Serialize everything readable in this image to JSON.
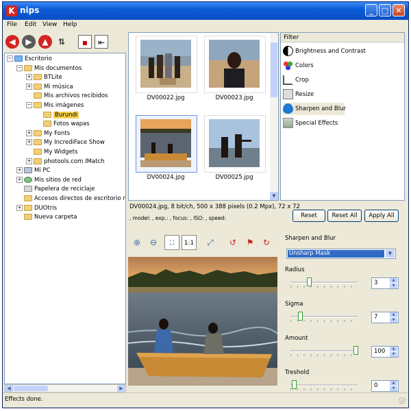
{
  "window": {
    "app_icon_glyph": "K",
    "title": "nips",
    "controls": {
      "minimize": "_",
      "maximize": "□",
      "close": "✕"
    }
  },
  "menu": [
    "File",
    "Edit",
    "View",
    "Help"
  ],
  "toolbar": [
    {
      "name": "back-icon",
      "glyph": "◀",
      "color": "#d32424"
    },
    {
      "name": "forward-icon",
      "glyph": "▶",
      "color": "#5a5a5a"
    },
    {
      "name": "up-icon",
      "glyph": "▲",
      "color": "#d32424"
    },
    {
      "name": "refresh-icon",
      "glyph": "⇅",
      "color": "#333333"
    }
  ],
  "tree": [
    {
      "label": "Escritorio",
      "depth": 0,
      "expander": "−",
      "folder": "desktop"
    },
    {
      "label": "Mis documentos",
      "depth": 1,
      "expander": "−",
      "folder": "docs"
    },
    {
      "label": "BTLite",
      "depth": 2,
      "expander": "+"
    },
    {
      "label": "Mi música",
      "depth": 2,
      "expander": "+"
    },
    {
      "label": "Mis archivos recibidos",
      "depth": 2,
      "expander": ""
    },
    {
      "label": "Mis imágenes",
      "depth": 2,
      "expander": "−"
    },
    {
      "label": "Burundi",
      "depth": 3,
      "expander": "",
      "selected": true
    },
    {
      "label": "Fotos wapas",
      "depth": 3,
      "expander": ""
    },
    {
      "label": "My Fonts",
      "depth": 2,
      "expander": "+"
    },
    {
      "label": "My IncrediFace Show",
      "depth": 2,
      "expander": "+"
    },
    {
      "label": "My Widgets",
      "depth": 2,
      "expander": ""
    },
    {
      "label": "photools.com IMatch",
      "depth": 2,
      "expander": "+"
    },
    {
      "label": "Mi PC",
      "depth": 1,
      "expander": "+",
      "folder": "pc"
    },
    {
      "label": "Mis sitios de red",
      "depth": 1,
      "expander": "+",
      "folder": "net"
    },
    {
      "label": "Papelera de reciclaje",
      "depth": 1,
      "expander": "",
      "folder": "trash"
    },
    {
      "label": "Accesos directos de escritorio no u",
      "depth": 1,
      "expander": ""
    },
    {
      "label": "DUOtris",
      "depth": 1,
      "expander": "+"
    },
    {
      "label": "Nueva carpeta",
      "depth": 1,
      "expander": ""
    }
  ],
  "thumbnails": [
    {
      "caption": "DV00022.jpg",
      "active": false
    },
    {
      "caption": "DV00023.jpg",
      "active": false
    },
    {
      "caption": "DV00024.jpg",
      "active": true
    },
    {
      "caption": "DV00025.jpg",
      "active": false
    }
  ],
  "image_info": {
    "line1": "DV00024.jpg, 8 bit/ch, 500 x 388 pixels (0.2 Mpx), 72 x 72",
    "line2": ", model: , exp.: , focus: , ISO: , speed:"
  },
  "image_tools": [
    {
      "name": "zoom-in-icon",
      "glyph": "⊕",
      "boxed": false
    },
    {
      "name": "zoom-out-icon",
      "glyph": "⊖",
      "boxed": false
    },
    {
      "name": "fit-window-icon",
      "glyph": "⛶",
      "boxed": true
    },
    {
      "name": "actual-size-icon",
      "glyph": "1:1",
      "boxed": true
    },
    {
      "name": "fullscreen-icon",
      "glyph": "⤢",
      "boxed": false
    },
    {
      "name": "rotate-left-icon",
      "glyph": "↺",
      "boxed": false
    },
    {
      "name": "flag-icon",
      "glyph": "⚑",
      "boxed": false
    },
    {
      "name": "rotate-right-icon",
      "glyph": "↻",
      "boxed": false
    }
  ],
  "filter_panel": {
    "header": "Filter",
    "items": [
      {
        "label": "Brightness and Contrast",
        "icon": "brightness-icon"
      },
      {
        "label": "Colors",
        "icon": "colors-icon"
      },
      {
        "label": "Crop",
        "icon": "crop-icon"
      },
      {
        "label": "Resize",
        "icon": "resize-icon"
      },
      {
        "label": "Sharpen and Blur",
        "icon": "sharpen-icon",
        "selected": true
      },
      {
        "label": "Special Effects",
        "icon": "effects-icon"
      }
    ]
  },
  "buttons": {
    "reset": "Reset",
    "reset_all": "Reset All",
    "apply_all": "Apply All"
  },
  "params": {
    "section_title": "Sharpen and Blur",
    "method": "Unsharp Mask",
    "controls": [
      {
        "label": "Radius",
        "value": "3",
        "fraction": 0.25
      },
      {
        "label": "Sigma",
        "value": "7",
        "fraction": 0.12
      },
      {
        "label": "Amount",
        "value": "100",
        "fraction": 0.98
      },
      {
        "label": "Treshold",
        "value": "0",
        "fraction": 0.02
      }
    ]
  },
  "status": "Effects done.",
  "colors": {
    "titlebar": "#0a5bd6",
    "selection": "#316ac5",
    "folder": "#f0d078"
  }
}
